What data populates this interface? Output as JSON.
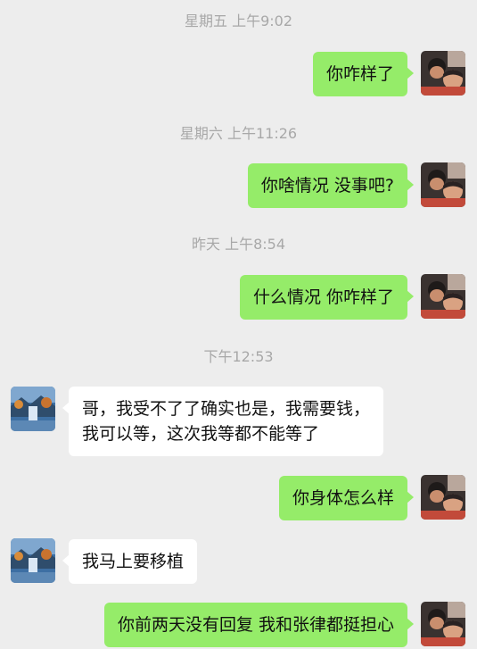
{
  "conversation": {
    "messages": [
      {
        "type": "timestamp",
        "text": "星期五 上午9:02"
      },
      {
        "type": "sent",
        "text": "你咋样了"
      },
      {
        "type": "timestamp",
        "text": "星期六 上午11:26"
      },
      {
        "type": "sent",
        "text": "你啥情况 没事吧?"
      },
      {
        "type": "timestamp",
        "text": "昨天 上午8:54"
      },
      {
        "type": "sent",
        "text": "什么情况 你咋样了"
      },
      {
        "type": "timestamp",
        "text": "下午12:53"
      },
      {
        "type": "received",
        "lines": [
          "哥，我受不了了确实也是，我需要钱，",
          "我可以等，这次我等都不能等了"
        ]
      },
      {
        "type": "sent",
        "text": "你身体怎么样"
      },
      {
        "type": "received",
        "text": "我马上要移植"
      },
      {
        "type": "sent",
        "text": "你前两天没有回复 我和张律都挺担心"
      }
    ]
  },
  "colors": {
    "background": "#ededed",
    "sent_bubble": "#95ec69",
    "received_bubble": "#ffffff",
    "timestamp_text": "#a8a8a8"
  },
  "avatars": {
    "self": "photo-avatar-two-people",
    "contact": "landscape-waterfall-avatar"
  }
}
